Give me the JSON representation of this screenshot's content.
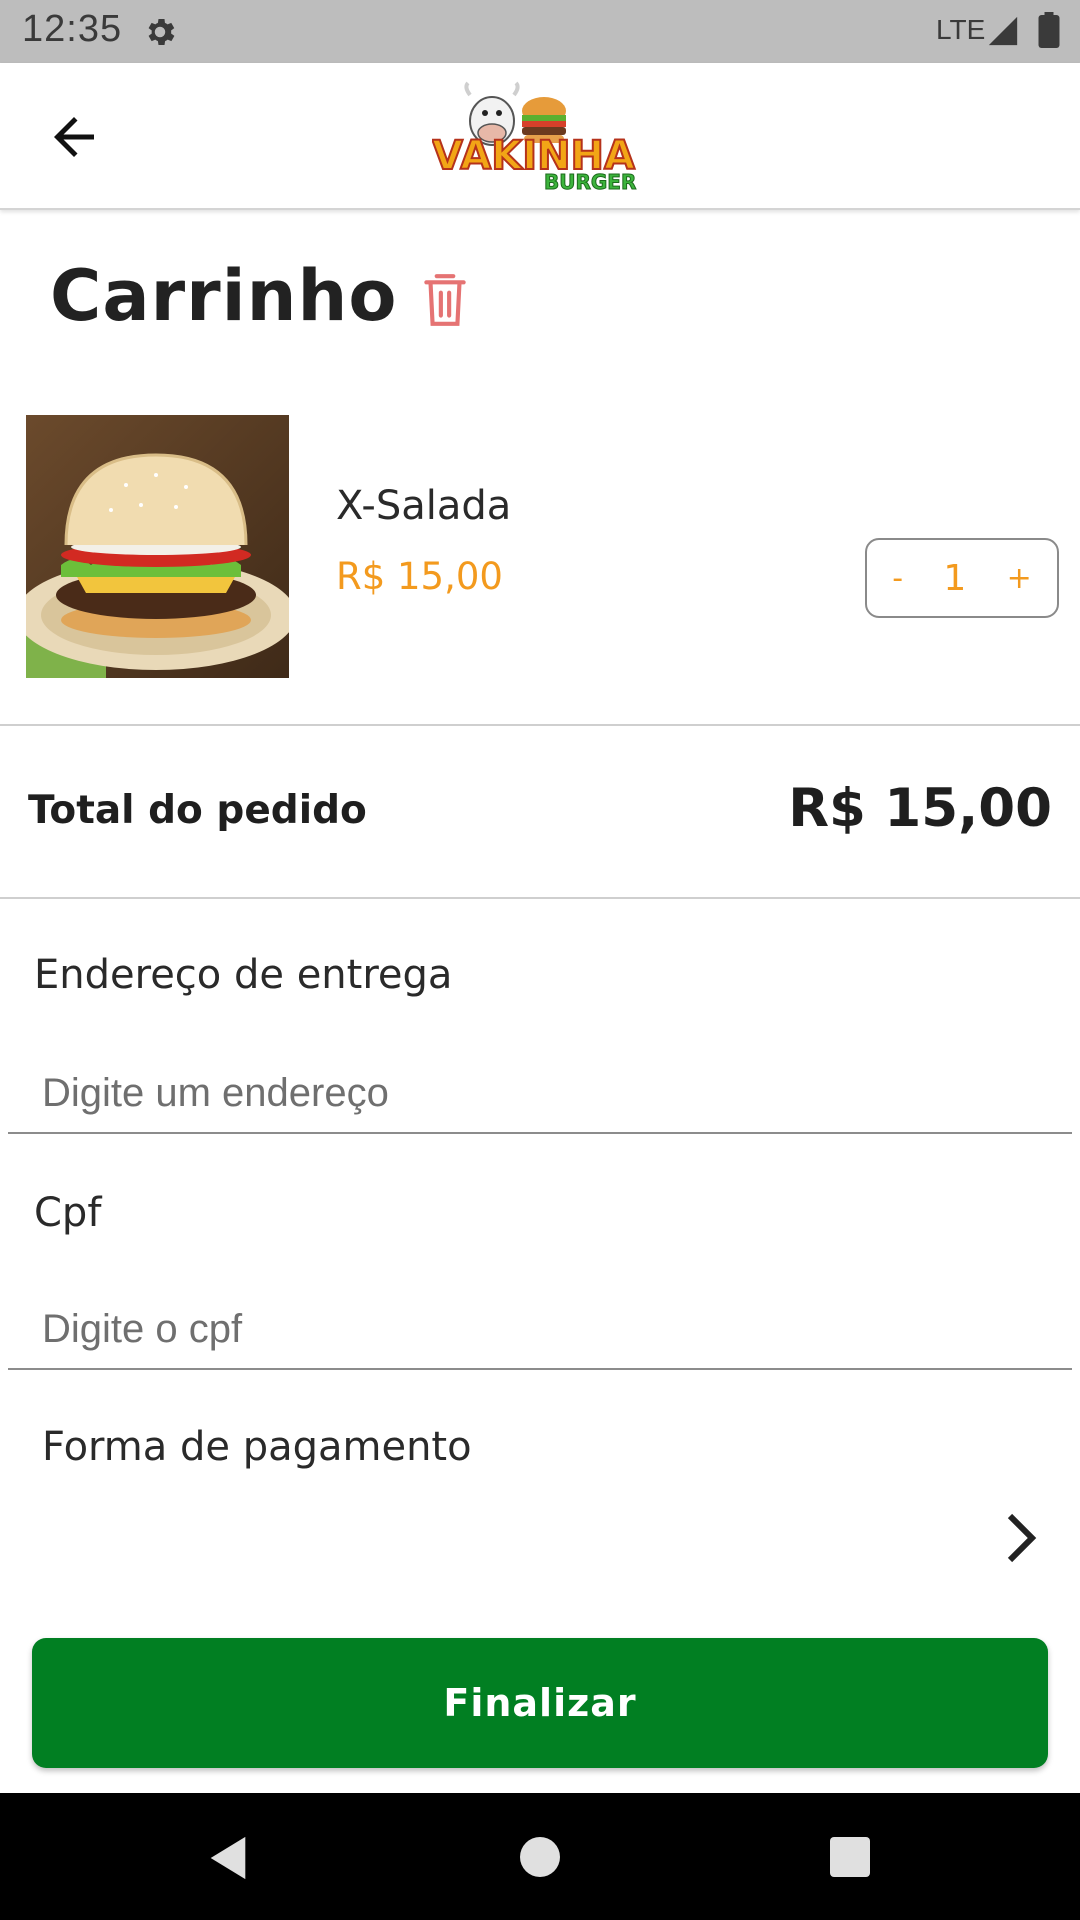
{
  "status_bar": {
    "time": "12:35",
    "network": "LTE",
    "icons": [
      "gear-icon",
      "signal-icon",
      "battery-icon"
    ]
  },
  "app_bar": {
    "back_icon": "arrow-left-icon",
    "logo_text_main": "VAKINHA",
    "logo_text_sub": "BURGER"
  },
  "cart": {
    "title": "Carrinho",
    "clear_icon": "trash-icon",
    "items": [
      {
        "name": "X-Salada",
        "price": "R$ 15,00",
        "quantity": "1",
        "minus_label": "-",
        "plus_label": "+"
      }
    ]
  },
  "total": {
    "label": "Total do pedido",
    "value": "R$ 15,00"
  },
  "form": {
    "address": {
      "label": "Endereço de entrega",
      "placeholder": "Digite um endereço",
      "value": ""
    },
    "cpf": {
      "label": "Cpf",
      "placeholder": "Digite o cpf",
      "value": ""
    },
    "payment": {
      "label": "Forma de pagamento",
      "icon": "chevron-right-icon"
    }
  },
  "finalize_label": "Finalizar",
  "colors": {
    "accent_orange": "#f39a1e",
    "primary_green": "#017f22",
    "status_bar": "#bdbdbd",
    "trash_red": "#e57373"
  }
}
